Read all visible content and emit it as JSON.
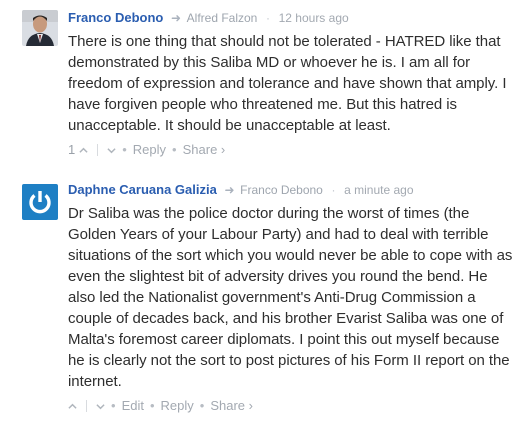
{
  "comments": [
    {
      "author": "Franco Debono",
      "reply_to": "Alfred Falzon",
      "time": "12 hours ago",
      "text": "There is one thing that should not be tolerated - HATRED like that demonstrated by this Saliba MD or whoever he is. I am all for freedom of expression and tolerance and have shown that amply. I have forgiven people who threatened me. But this hatred is unacceptable. It should be unacceptable at least.",
      "votes": "1",
      "actions": {
        "reply": "Reply",
        "share": "Share ›"
      }
    },
    {
      "author": "Daphne Caruana Galizia",
      "reply_to": "Franco Debono",
      "time": "a minute ago",
      "text": "Dr Saliba was the police doctor during the worst of times (the Golden Years of your Labour Party) and had to deal with terrible situations of the sort which you would never be able to cope with as even the slightest bit of adversity drives you round the bend. He also led the Nationalist government's Anti-Drug Commission a couple of decades back, and his brother Evarist Saliba was one of Malta's foremost career diplomats. I point this out myself because he is clearly not the sort to post pictures of his Form II report on the internet.",
      "actions": {
        "edit": "Edit",
        "reply": "Reply",
        "share": "Share ›"
      },
      "avatar_color": "#1e7fc4"
    }
  ],
  "icons": {
    "reply_arrow": "arrow-right-icon",
    "upvote": "chevron-up-icon",
    "downvote": "chevron-down-icon"
  }
}
